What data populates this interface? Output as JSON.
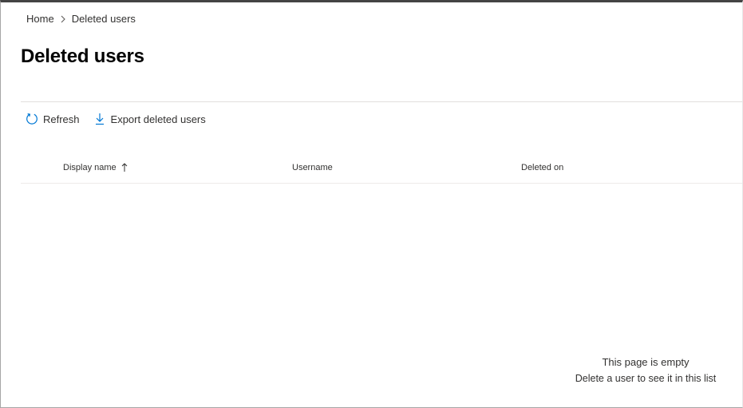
{
  "breadcrumb": {
    "items": [
      {
        "label": "Home"
      },
      {
        "label": "Deleted users"
      }
    ]
  },
  "page": {
    "title": "Deleted users"
  },
  "toolbar": {
    "refresh_label": "Refresh",
    "refresh_icon": "refresh-icon",
    "export_label": "Export deleted users",
    "export_icon": "download-icon"
  },
  "table": {
    "columns": [
      {
        "label": "Display name",
        "sorted": "ascending"
      },
      {
        "label": "Username"
      },
      {
        "label": "Deleted on"
      }
    ],
    "rows": []
  },
  "empty_state": {
    "title": "This page is empty",
    "message": "Delete a user to see it in this list"
  },
  "colors": {
    "accent": "#0078d4",
    "text": "#323130",
    "divider": "#e1dfdd"
  }
}
